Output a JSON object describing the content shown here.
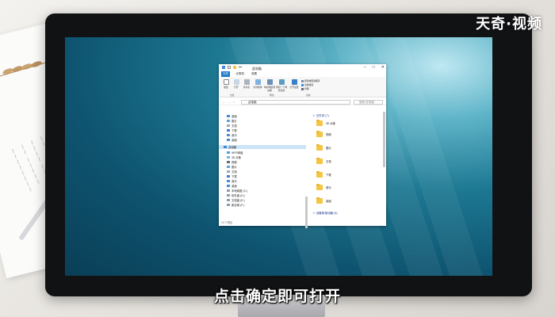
{
  "brand": "天奇·视频",
  "subtitle": "点击确定即可打开",
  "window": {
    "title": "此电脑",
    "menu": [
      "文件",
      "计算机",
      "查看"
    ],
    "ribbon": {
      "buttons": [
        "属性",
        "打开",
        "重命名",
        "访问媒体",
        "映射网络驱动器",
        "添加一个网络位置",
        "打开设置"
      ],
      "right_items": [
        "卸载或更改程序",
        "系统属性",
        "管理"
      ],
      "groups": [
        "位置",
        "网络",
        "系统"
      ]
    },
    "address": "此电脑",
    "search_placeholder": "搜索\"此电脑\"",
    "nav_items": [
      "桌面",
      "图片",
      "文档",
      "下载",
      "音乐",
      "桌面",
      "此电脑",
      "WPS网盘",
      "3D 对象",
      "视频",
      "图片",
      "文档",
      "下载",
      "音乐",
      "桌面",
      "本地磁盘 (C:)",
      "软件盘 (D:)",
      "文档盘 (E:)",
      "新加坡 (F:)"
    ],
    "groups": {
      "folders": "文件夹 (7)",
      "devices": "设备和驱动器 (6)"
    },
    "folders": [
      "3D 对象",
      "视频",
      "图片",
      "文档",
      "下载",
      "音乐",
      "桌面"
    ],
    "status": "13 个项目"
  },
  "colors": {
    "selection": "#cce4f7",
    "accent": "#1979ca",
    "folder": "#f4c542"
  }
}
